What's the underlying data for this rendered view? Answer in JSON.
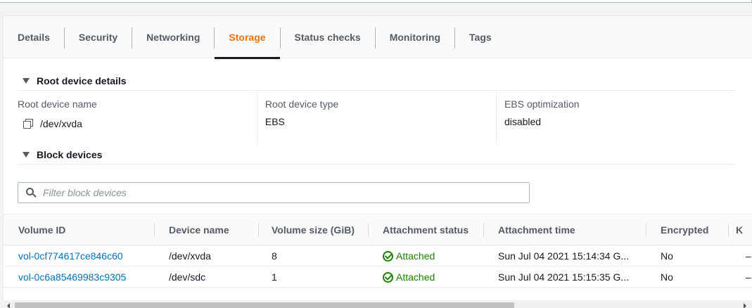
{
  "tabs": [
    {
      "label": "Details",
      "active": false
    },
    {
      "label": "Security",
      "active": false
    },
    {
      "label": "Networking",
      "active": false
    },
    {
      "label": "Storage",
      "active": true
    },
    {
      "label": "Status checks",
      "active": false
    },
    {
      "label": "Monitoring",
      "active": false
    },
    {
      "label": "Tags",
      "active": false
    }
  ],
  "root_device": {
    "section_title": "Root device details",
    "name_label": "Root device name",
    "name_value": "/dev/xvda",
    "type_label": "Root device type",
    "type_value": "EBS",
    "ebs_label": "EBS optimization",
    "ebs_value": "disabled"
  },
  "block_devices": {
    "section_title": "Block devices",
    "filter_placeholder": "Filter block devices",
    "columns": [
      "Volume ID",
      "Device name",
      "Volume size (GiB)",
      "Attachment status",
      "Attachment time",
      "Encrypted",
      "K"
    ],
    "rows": [
      {
        "volume_id": "vol-0cf774617ce846c60",
        "device": "/dev/xvda",
        "size": "8",
        "status": "Attached",
        "time": "Sun Jul 04 2021 15:14:34 G...",
        "encrypted": "No",
        "extra": "–"
      },
      {
        "volume_id": "vol-0c6a85469983c9305",
        "device": "/dev/sdc",
        "size": "1",
        "status": "Attached",
        "time": "Sun Jul 04 2021 15:15:35 G...",
        "encrypted": "No",
        "extra": "–"
      }
    ]
  },
  "colors": {
    "accent": "#ec7211",
    "link": "#0073bb",
    "success": "#1d8102"
  },
  "icons": [
    "caret-down-icon",
    "copy-icon",
    "search-icon",
    "check-circle-icon"
  ]
}
